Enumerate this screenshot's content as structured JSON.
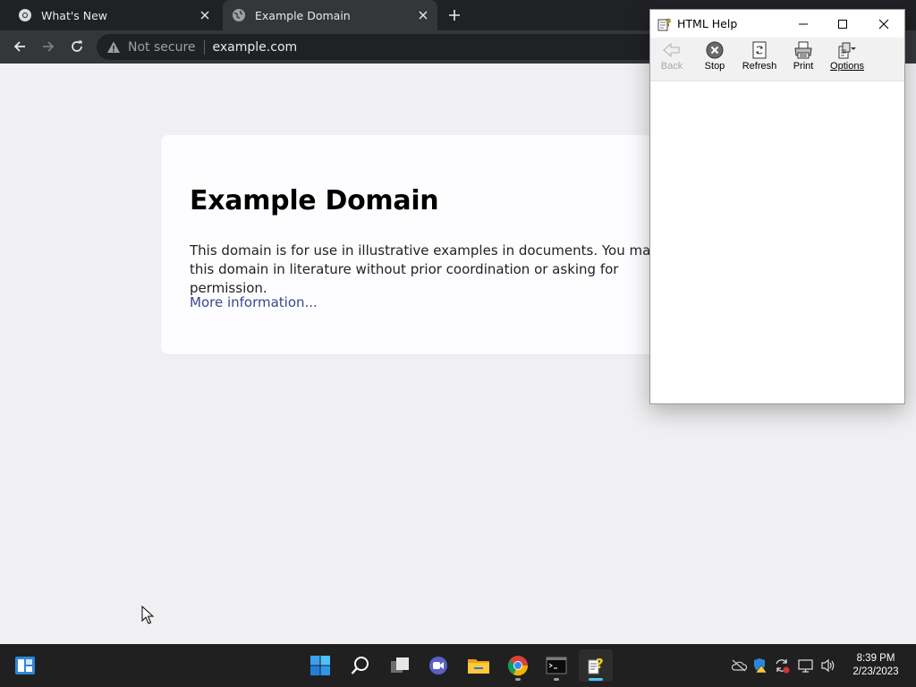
{
  "browser": {
    "tabs": [
      {
        "label": "What's New",
        "icon": "chrome-icon"
      },
      {
        "label": "Example Domain",
        "icon": "globe-icon"
      }
    ],
    "security_label": "Not secure",
    "url": "example.com"
  },
  "page": {
    "heading": "Example Domain",
    "paragraph": "This domain is for use in illustrative examples in documents. You may use this domain in literature without prior coordination or asking for permission.",
    "link": "More information..."
  },
  "help_window": {
    "title": "HTML Help",
    "toolbar": [
      {
        "label": "Back",
        "icon": "back-arrow-icon",
        "enabled": false
      },
      {
        "label": "Stop",
        "icon": "stop-icon",
        "enabled": true
      },
      {
        "label": "Refresh",
        "icon": "refresh-icon",
        "enabled": true
      },
      {
        "label": "Print",
        "icon": "print-icon",
        "enabled": true
      },
      {
        "label": "Options",
        "icon": "options-icon",
        "enabled": true
      }
    ]
  },
  "taskbar": {
    "clock_time": "8:39 PM",
    "clock_date": "2/23/2023",
    "apps": [
      "widgets-icon",
      "start-icon",
      "search-icon",
      "task-view-icon",
      "chat-icon",
      "file-explorer-icon",
      "chrome-icon",
      "terminal-icon",
      "html-help-icon"
    ]
  },
  "colors": {
    "chrome_dark": "#202124",
    "chrome_toolbar": "#35363a",
    "page_bg": "#f0f0f2",
    "link": "#38488f",
    "taskbar": "#202020",
    "accent": "#4cc2ff"
  }
}
